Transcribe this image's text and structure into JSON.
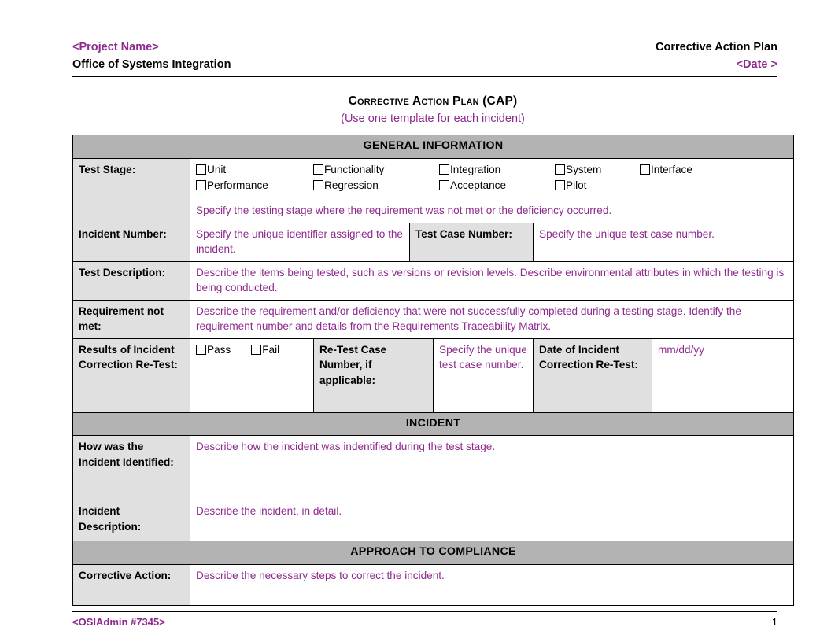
{
  "header": {
    "project_name": "<Project Name>",
    "office": "Office of Systems Integration",
    "doc_type": "Corrective Action Plan",
    "date": "<Date >"
  },
  "title": {
    "main": "Corrective Action Plan (CAP)",
    "subtitle": "(Use one template for each incident)"
  },
  "sections": {
    "general_information": "GENERAL INFORMATION",
    "incident": "INCIDENT",
    "approach_to_compliance": "APPROACH TO COMPLIANCE"
  },
  "test_stage": {
    "label": "Test Stage:",
    "checkboxes_row1": [
      "Unit",
      "Functionality",
      "Integration",
      "System",
      "Interface"
    ],
    "checkboxes_row2": [
      "Performance",
      "Regression",
      "Acceptance",
      "Pilot"
    ],
    "hint": "Specify the testing stage where the requirement was not met or the deficiency occurred."
  },
  "incident_number": {
    "label": "Incident Number:",
    "value": "Specify the unique identifier assigned to the incident.",
    "test_case_number_label": "Test Case Number:",
    "test_case_number_value": "Specify the unique test case number."
  },
  "test_description": {
    "label": "Test Description:",
    "value": "Describe the items being tested, such as versions or revision levels. Describe environmental attributes in which the testing is being conducted."
  },
  "requirement_not_met": {
    "label": "Requirement not met:",
    "value": "Describe the requirement and/or deficiency that were not successfully completed during a testing stage. Identify the requirement number and details from the Requirements Traceability Matrix."
  },
  "retest_results": {
    "label": "Results of Incident Correction Re-Test:",
    "pass": "Pass",
    "fail": "Fail",
    "retest_case_number_label": "Re-Test Case Number, if applicable:",
    "retest_case_number_value": "Specify the unique test case number.",
    "date_label": "Date of Incident Correction Re-Test:",
    "date_value": "mm/dd/yy"
  },
  "how_identified": {
    "label": "How was the Incident Identified:",
    "value": "Describe how the incident was indentified during the test stage."
  },
  "incident_description": {
    "label": "Incident Description:",
    "value": "Describe the incident, in detail."
  },
  "corrective_action": {
    "label": "Corrective Action:",
    "value": "Describe the necessary steps to correct the incident."
  },
  "footer": {
    "doc_id": "<OSIAdmin #7345>",
    "page_number": "1"
  },
  "colors": {
    "accent_purple": "#8e2a8e",
    "section_band_gray": "#b3b3b3",
    "label_cell_gray": "#e0e0e0"
  }
}
